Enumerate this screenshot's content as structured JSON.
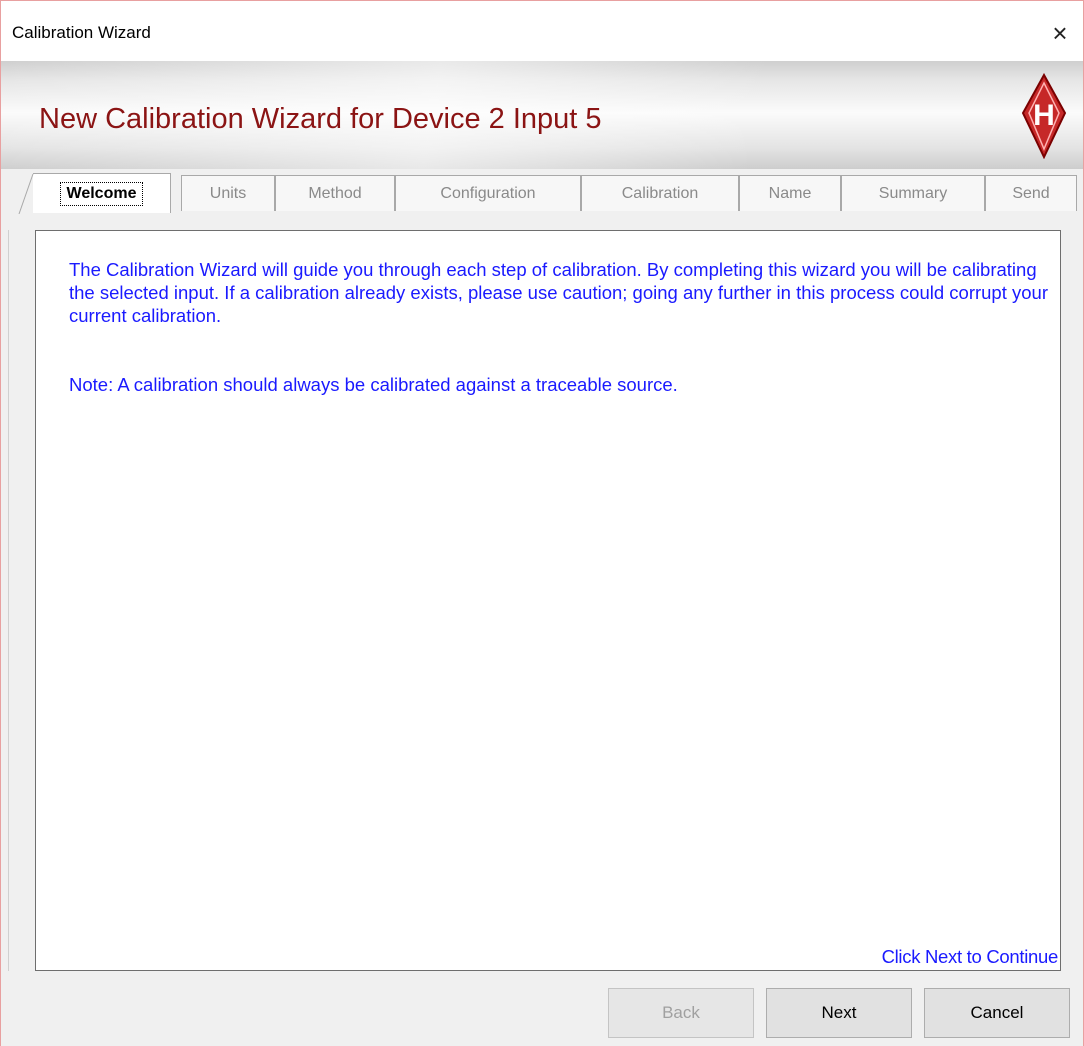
{
  "window": {
    "title": "Calibration Wizard",
    "close_glyph": "×"
  },
  "banner": {
    "heading": "New Calibration Wizard for Device 2 Input 5",
    "logo_letter": "H"
  },
  "tabs": [
    {
      "label": "Welcome",
      "active": true
    },
    {
      "label": "Units",
      "active": false
    },
    {
      "label": "Method",
      "active": false
    },
    {
      "label": "Configuration",
      "active": false
    },
    {
      "label": "Calibration",
      "active": false
    },
    {
      "label": "Name",
      "active": false
    },
    {
      "label": "Summary",
      "active": false
    },
    {
      "label": "Send",
      "active": false
    }
  ],
  "content": {
    "intro": "The Calibration Wizard will guide you through each step of calibration.  By completing this wizard you will be calibrating the selected input.  If a calibration already exists, please use caution; going any further in this process could corrupt your current calibration.",
    "note": "Note:  A calibration should always be calibrated against a traceable source.",
    "hint": "Click Next to Continue"
  },
  "buttons": {
    "back": "Back",
    "next": "Next",
    "cancel": "Cancel",
    "back_enabled": false
  },
  "colors": {
    "heading": "#8b1414",
    "body_text": "#1a1aff",
    "logo": "#c62828"
  }
}
